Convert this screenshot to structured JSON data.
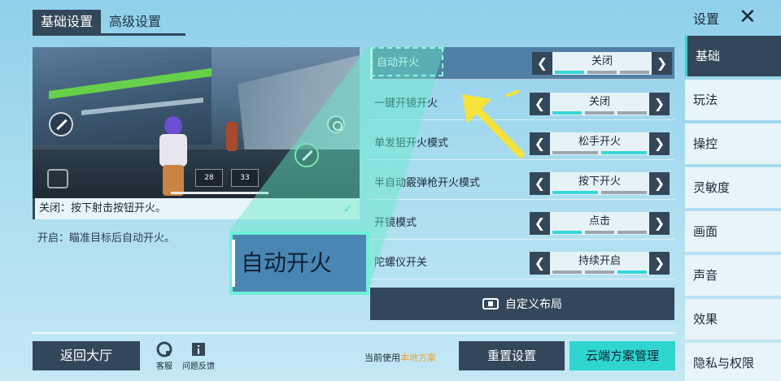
{
  "tabs": [
    {
      "label": "基础设置",
      "active": true
    },
    {
      "label": "高级设置",
      "active": false
    }
  ],
  "preview": {
    "hud_ammo": "28",
    "hud_ammo2": "33"
  },
  "descriptions": {
    "off": "关闭：按下射击按钮开火。",
    "on": "开启：瞄准目标后自动开火。"
  },
  "tutorial": {
    "highlight_label": "自动开火"
  },
  "options": [
    {
      "label": "自动开火",
      "value": "关闭",
      "level": 0.33,
      "active": true
    },
    {
      "label": "一键开镜开火",
      "value": "关闭",
      "level": 0.33,
      "active": false
    },
    {
      "label": "单发狙开火模式",
      "value": "松手开火",
      "level": 0.66,
      "active": false
    },
    {
      "label": "半自动霰弹枪开火模式",
      "value": "按下开火",
      "level": 0.33,
      "active": false
    },
    {
      "label": "开镜模式",
      "value": "点击",
      "level": 0.33,
      "active": false
    },
    {
      "label": "陀螺仪开关",
      "value": "持续开启",
      "level": 1.0,
      "active": false
    }
  ],
  "custom_layout_label": "自定义布局",
  "bottom": {
    "back_label": "返回大厅",
    "service_label": "客服",
    "feedback_label": "问题反馈",
    "current_prefix": "当前使用",
    "current_scheme": "本地方案",
    "reset_label": "重置设置",
    "cloud_label": "云端方案管理"
  },
  "sidebar": {
    "title": "设置",
    "items": [
      {
        "label": "基础",
        "active": true
      },
      {
        "label": "玩法",
        "active": false
      },
      {
        "label": "操控",
        "active": false
      },
      {
        "label": "灵敏度",
        "active": false
      },
      {
        "label": "画面",
        "active": false
      },
      {
        "label": "声音",
        "active": false
      },
      {
        "label": "效果",
        "active": false
      },
      {
        "label": "隐私与权限",
        "active": false
      }
    ]
  },
  "colors": {
    "dark": "#33475a",
    "accent": "#2fd6d0",
    "highlight": "#6ff0d8",
    "arrow": "#f6e23a"
  }
}
